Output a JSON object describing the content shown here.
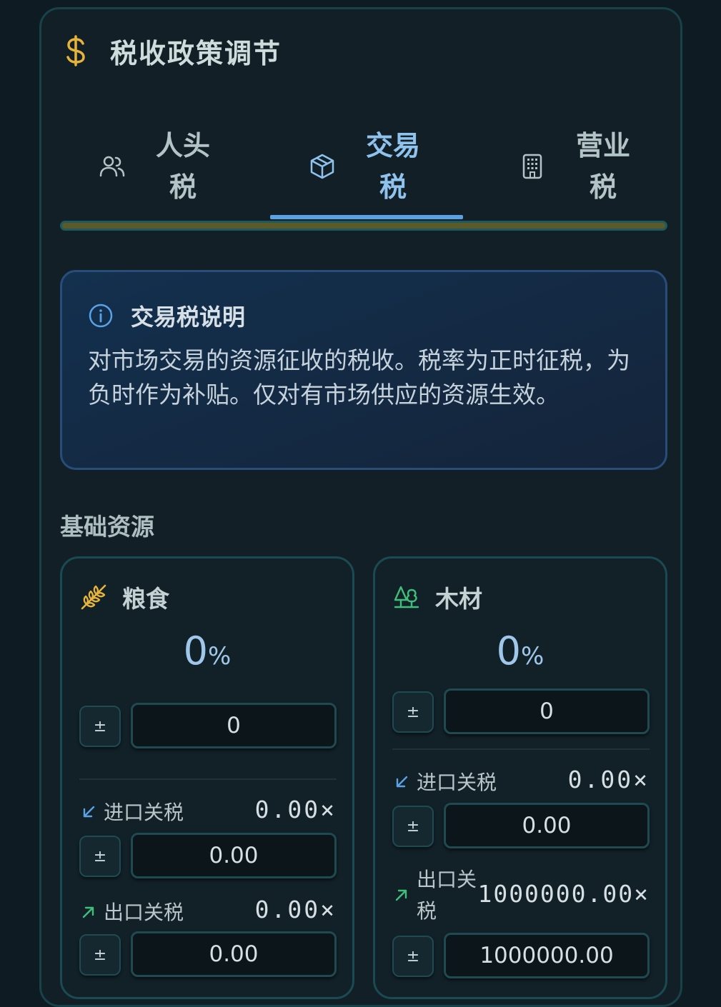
{
  "header": {
    "title": "税收政策调节",
    "icon": "dollar-icon",
    "icon_color": "#e7b43b"
  },
  "tabs": [
    {
      "label": "人头税",
      "icon": "users-icon",
      "active": false
    },
    {
      "label": "交易税",
      "icon": "box-icon",
      "active": true
    },
    {
      "label": "营业税",
      "icon": "building-icon",
      "active": false
    }
  ],
  "info": {
    "title": "交易税说明",
    "body": "对市场交易的资源征收的税收。税率为正时征税，为负时作为补贴。仅对有市场供应的资源生效。"
  },
  "section": {
    "title": "基础资源"
  },
  "resources": [
    {
      "name": "粮食",
      "icon": "wheat-icon",
      "icon_color": "#e7b43b",
      "rate_value": "0",
      "rate_unit": "%",
      "pm_label": "±",
      "tax_input": "0",
      "import_label": "进口关税",
      "import_value": "0.00×",
      "import_input": "0.00",
      "export_label": "出口关税",
      "export_value": "0.00×",
      "export_input": "0.00"
    },
    {
      "name": "木材",
      "icon": "tree-icon",
      "icon_color": "#3fbf7a",
      "rate_value": "0",
      "rate_unit": "%",
      "pm_label": "±",
      "tax_input": "0",
      "import_label": "进口关税",
      "import_value": "0.00×",
      "import_input": "0.00",
      "export_label": "出口关税",
      "export_value": "1000000.00×",
      "export_input": "1000000.00"
    }
  ],
  "colors": {
    "accent": "#5aa2e6",
    "import_arrow": "#5aa2e6",
    "export_arrow": "#3fbf7a"
  }
}
